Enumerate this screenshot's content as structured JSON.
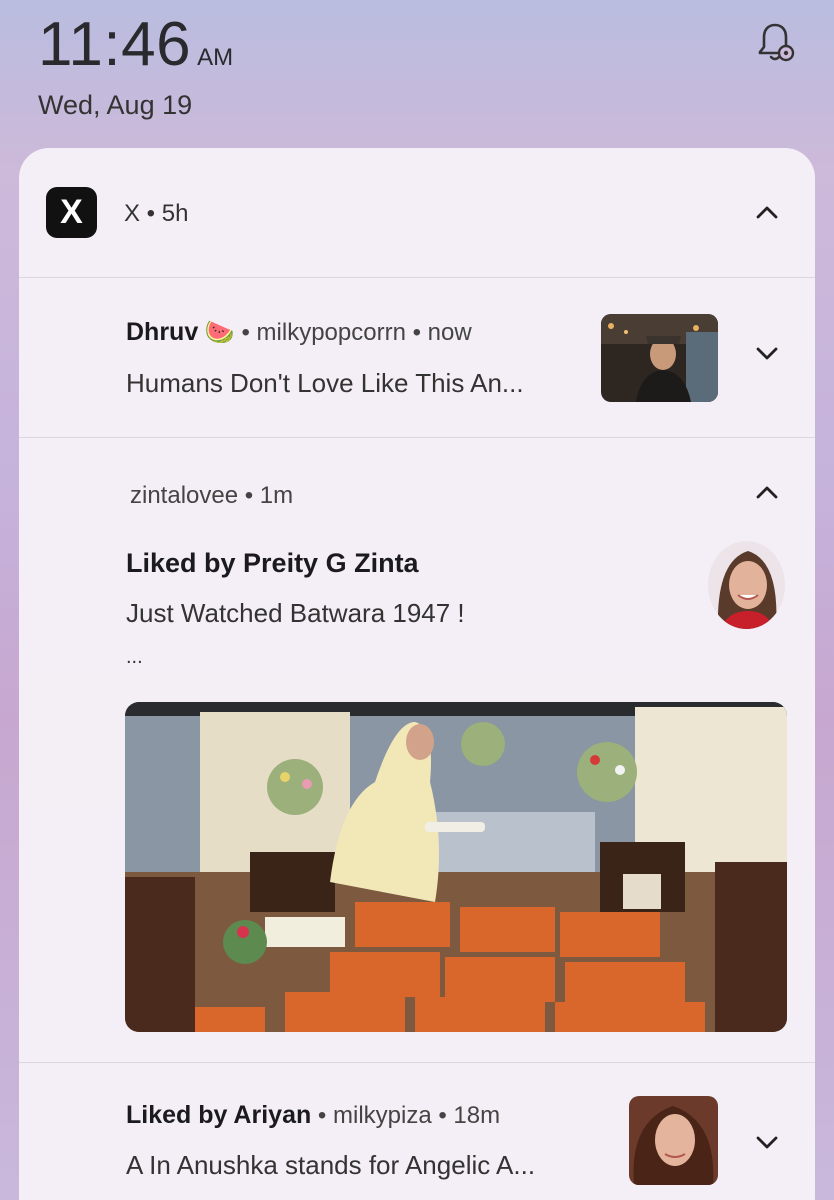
{
  "status_bar": {
    "time": "11:46",
    "ampm": "AM",
    "date": "Wed, Aug 19",
    "bell_icon": "notification-settings-icon"
  },
  "app": {
    "icon_letter": "X",
    "name_time": "X • 5h"
  },
  "notifications": [
    {
      "sender": "Dhruv",
      "emoji": "🍉",
      "handle": "• milkypopcorrn • now",
      "text": "Humans Don't Love Like This An..."
    },
    {
      "handle_time": "zintalovee • 1m",
      "title": "Liked by Preity G Zinta",
      "text": "Just Watched Batwara 1947 !",
      "ellipsis": "..."
    },
    {
      "sender": "Liked by Ariyan",
      "handle": "• milkypiza • 18m",
      "text": "A In Anushka stands for Angelic A..."
    }
  ],
  "colors": {
    "background": "#c6b3dc",
    "card": "#f6f1f7",
    "app_icon_bg": "#111111"
  }
}
